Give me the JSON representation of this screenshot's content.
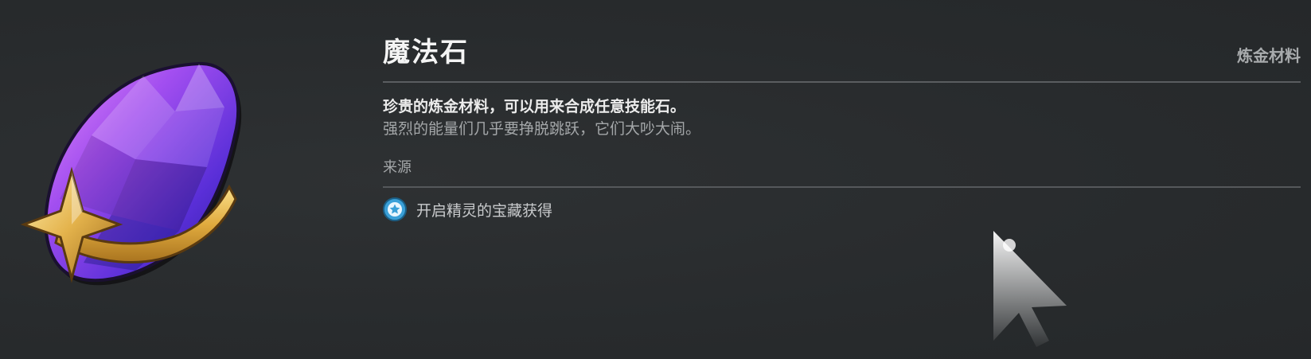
{
  "item": {
    "name": "魔法石",
    "category": "炼金材料",
    "description_primary": "珍贵的炼金材料，可以用来合成任意技能石。",
    "description_secondary": "强烈的能量们几乎要挣脱跳跃，它们大吵大闹。",
    "icon": "magic-stone-gem-icon"
  },
  "source": {
    "label": "来源",
    "entries": [
      {
        "text": "开启精灵的宝藏获得",
        "icon": "star-badge-icon"
      }
    ]
  },
  "colors": {
    "background": "#2a2d2f",
    "gem_purple": "#8a3cf0",
    "gold_trim": "#e2b247",
    "badge_blue": "#3aa0d8"
  }
}
